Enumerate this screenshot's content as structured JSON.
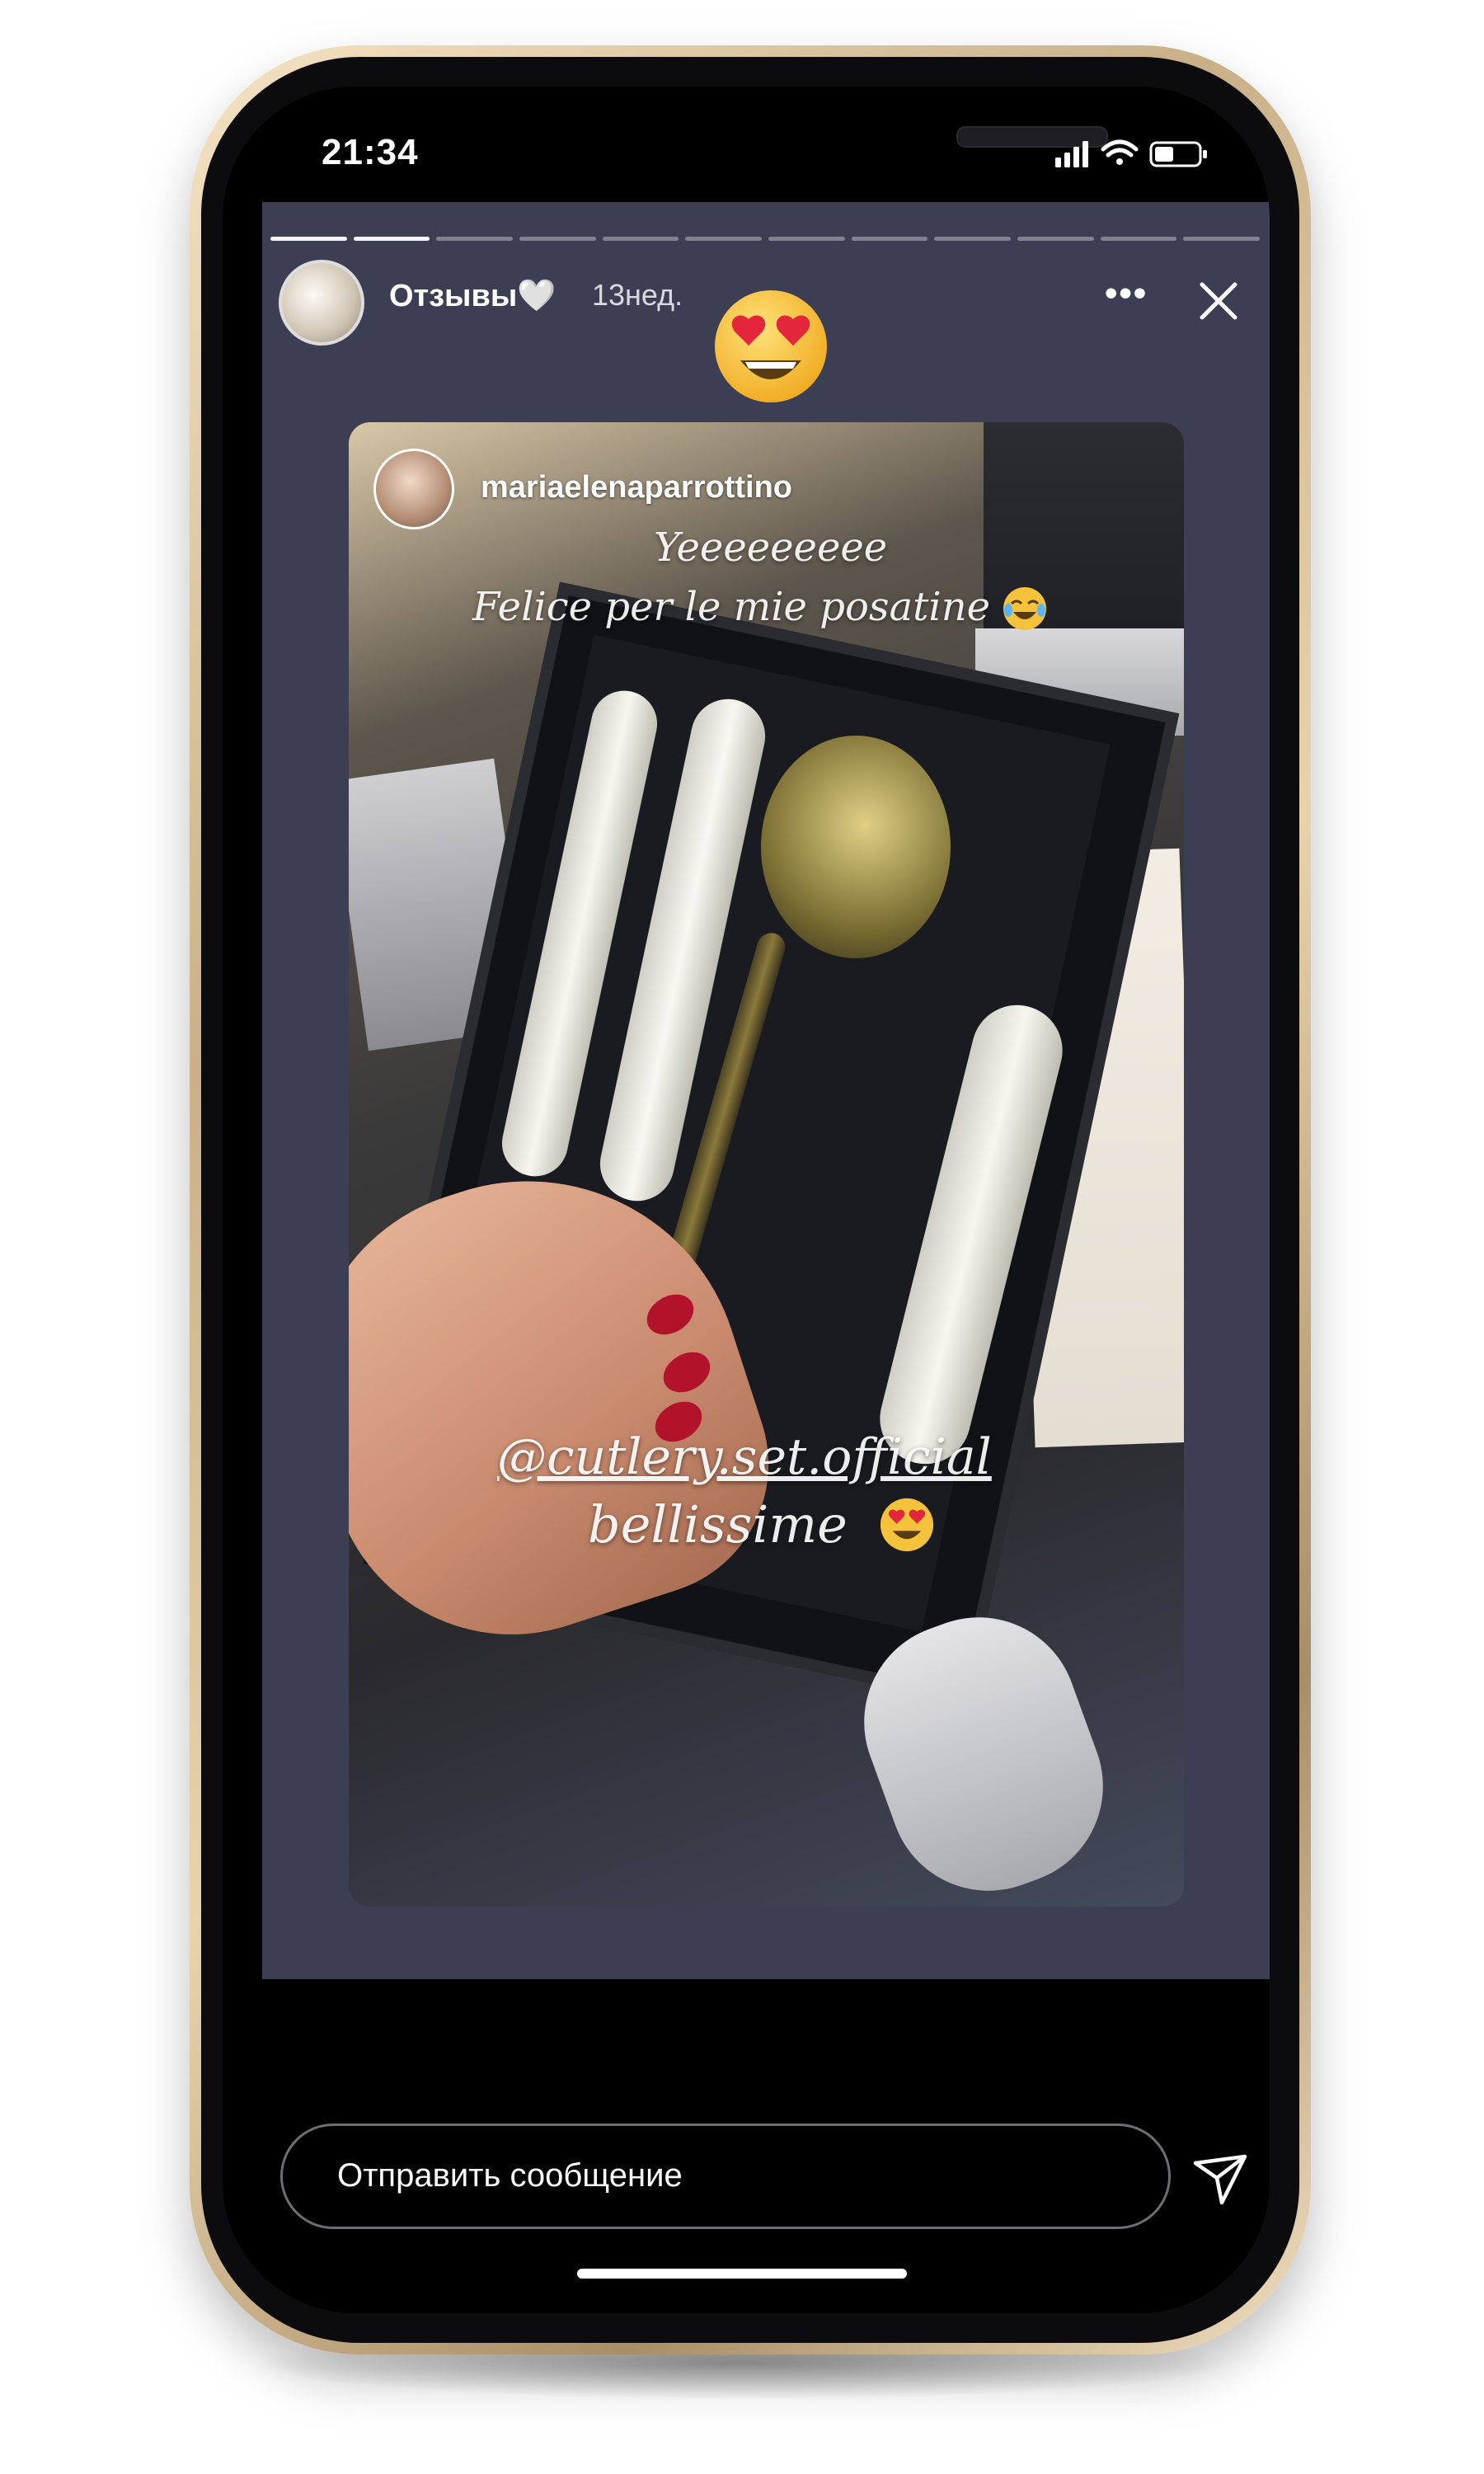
{
  "status_bar": {
    "time": "21:34",
    "signal_icon": "signal-bars-icon",
    "wifi_icon": "wifi-icon",
    "battery_icon": "battery-icon"
  },
  "story": {
    "segments_total": 12,
    "segments_done": 2,
    "account_name": "Отзывы🤍",
    "time_ago": "13нед.",
    "more_icon": "more-icon",
    "close_icon": "close-icon",
    "sticker_icon": "heart-eyes-emoji-icon"
  },
  "post": {
    "username": "mariaelenaparrottino",
    "line1": "Yeeeeeeeee",
    "line2": "Felice per le mie posatine",
    "line2_emoji": "tears-of-joy-emoji-icon",
    "mention": "@cutlery.set.official",
    "caption": "bellissime",
    "caption_emoji": "heart-eyes-emoji-icon"
  },
  "reply": {
    "placeholder": "Отправить сообщение",
    "send_icon": "paper-plane-icon"
  },
  "colors": {
    "story_bg": "#3c3f54",
    "frame_gold": "#c9b089",
    "nail_red": "#b3122b"
  }
}
